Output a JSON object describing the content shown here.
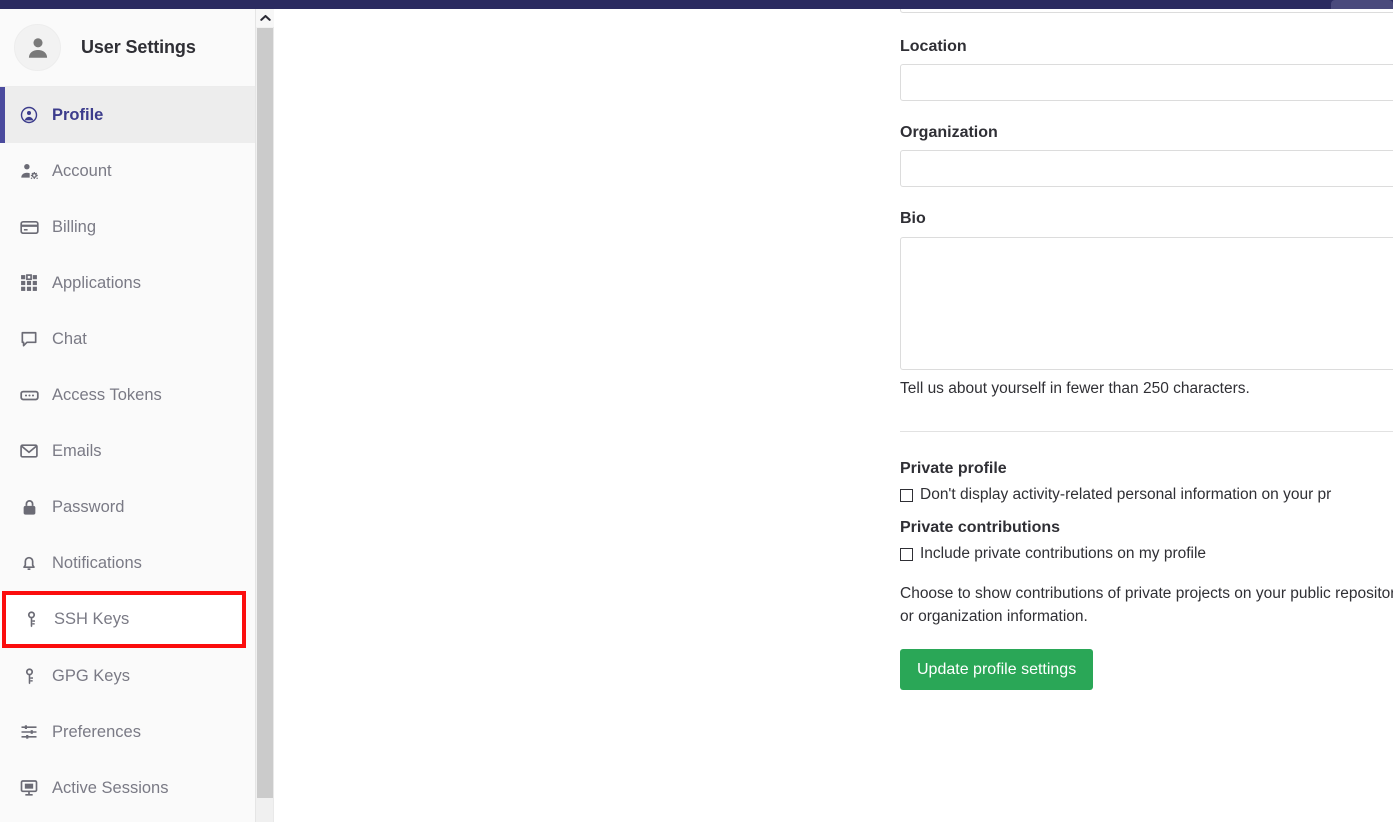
{
  "navbar": {
    "pill_label": "",
    "background_color": "#2b2b60",
    "pill_color": "#4a4a7c"
  },
  "sidebar": {
    "title": "User Settings",
    "avatar_icon": "user-avatar-icon",
    "active_item": "Profile",
    "highlighted_item": "SSH Keys",
    "highlight_color": "#fb0d0d",
    "active_accent_color": "#4b4b9e",
    "items": [
      {
        "label": "Profile",
        "icon": "user-circle-icon",
        "active": true
      },
      {
        "label": "Account",
        "icon": "account-gear-icon",
        "active": false
      },
      {
        "label": "Billing",
        "icon": "credit-card-icon",
        "active": false
      },
      {
        "label": "Applications",
        "icon": "grid-apps-icon",
        "active": false
      },
      {
        "label": "Chat",
        "icon": "chat-bubble-icon",
        "active": false
      },
      {
        "label": "Access Tokens",
        "icon": "token-card-icon",
        "active": false
      },
      {
        "label": "Emails",
        "icon": "envelope-icon",
        "active": false
      },
      {
        "label": "Password",
        "icon": "lock-icon",
        "active": false
      },
      {
        "label": "Notifications",
        "icon": "bell-icon",
        "active": false
      },
      {
        "label": "SSH Keys",
        "icon": "key-icon",
        "active": false
      },
      {
        "label": "GPG Keys",
        "icon": "key-icon",
        "active": false
      },
      {
        "label": "Preferences",
        "icon": "sliders-icon",
        "active": false
      },
      {
        "label": "Active Sessions",
        "icon": "monitor-icon",
        "active": false
      }
    ]
  },
  "scrollbar": {
    "up_arrow_icon": "chevron-up-icon"
  },
  "main": {
    "fields": {
      "top_partial_value": "",
      "location_label": "Location",
      "location_value": "",
      "organization_label": "Organization",
      "organization_value": "",
      "bio_label": "Bio",
      "bio_value": "",
      "bio_helper": "Tell us about yourself in fewer than 250 characters."
    },
    "private_profile": {
      "heading": "Private profile",
      "checkbox_label": "Don't display activity-related personal information on your pr",
      "checked": false
    },
    "private_contributions": {
      "heading": "Private contributions",
      "checkbox_label": "Include private contributions on my profile",
      "checked": false,
      "description": "Choose to show contributions of private projects on your public repository or organization information."
    },
    "submit_button": {
      "label": "Update profile settings",
      "color": "#2aa757"
    }
  }
}
